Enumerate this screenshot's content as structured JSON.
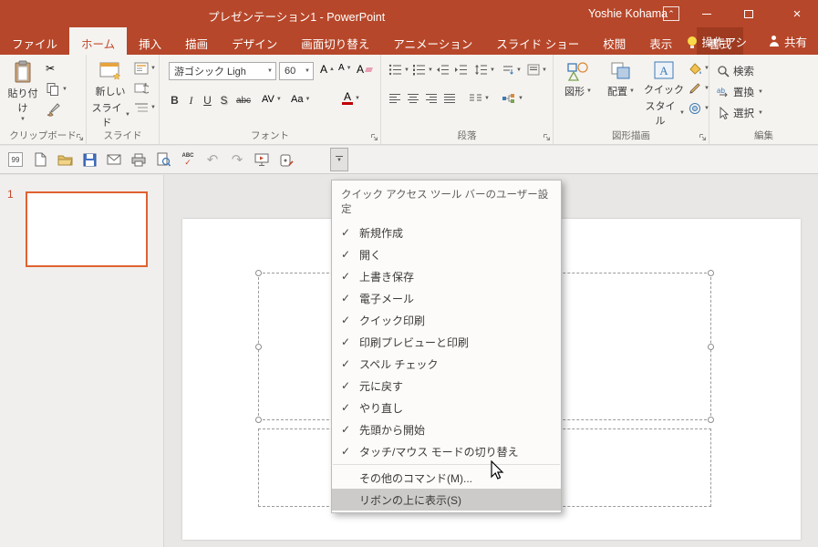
{
  "window": {
    "title": "プレゼンテーション1 - PowerPoint",
    "user": "Yoshie Kohama"
  },
  "tabs": {
    "file": "ファイル",
    "items": [
      "ホーム",
      "挿入",
      "描画",
      "デザイン",
      "画面切り替え",
      "アニメーション",
      "スライド ショー",
      "校閲",
      "表示"
    ],
    "active_tab": "ホーム",
    "contextual": "書式",
    "tell_me": "操作アシ",
    "share": "共有"
  },
  "ribbon": {
    "clipboard": {
      "label": "クリップボード",
      "paste": "貼り付け"
    },
    "slides": {
      "label": "スライド",
      "new_slide": [
        "新しい",
        "スライド"
      ]
    },
    "font": {
      "label": "フォント",
      "name": "游ゴシック Ligh",
      "size": "60",
      "bold": "B",
      "italic": "I",
      "underline": "U",
      "shadow": "S",
      "strike": "abc",
      "spacing": "AV",
      "case_btn": "Aa",
      "grow": "A",
      "shrink": "A",
      "clear": "A",
      "color": "A"
    },
    "paragraph": {
      "label": "段落"
    },
    "drawing": {
      "label": "図形描画",
      "shapes": "図形",
      "arrange": "配置",
      "quick_style": [
        "クイック",
        "スタイル"
      ]
    },
    "editing": {
      "label": "編集",
      "find": "検索",
      "replace": "置換",
      "select": "選択"
    }
  },
  "qat": {
    "icons": [
      "number-grid",
      "new-document",
      "open",
      "save",
      "email",
      "quick-print",
      "print-preview",
      "spelling",
      "undo",
      "redo",
      "start-from-beginning",
      "touch-mouse-mode",
      "customize-dropdown"
    ],
    "number_badge": "99"
  },
  "menu": {
    "header": "クイック アクセス ツール バーのユーザー設定",
    "checked": [
      "新規作成",
      "開く",
      "上書き保存",
      "電子メール",
      "クイック印刷",
      "印刷プレビューと印刷",
      "スペル チェック",
      "元に戻す",
      "やり直し",
      "先頭から開始",
      "タッチ/マウス モードの切り替え"
    ],
    "more": "その他のコマンド(M)...",
    "show_above": "リボンの上に表示(S)"
  },
  "slides_panel": {
    "number": "1"
  },
  "colors": {
    "accent": "#B7472A",
    "thumbnail_border": "#E0622F",
    "menu_highlight": "#CDCBC9"
  }
}
